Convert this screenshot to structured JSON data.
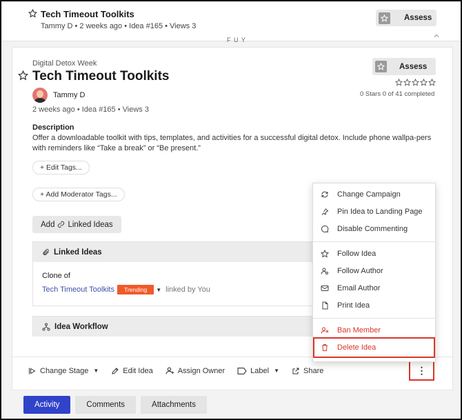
{
  "header": {
    "title": "Tech Timeout Toolkits",
    "meta": "Tammy D • 2 weeks ago • Idea #165 • Views 3",
    "assess_label": "Assess",
    "cut_text": "F U Y"
  },
  "idea": {
    "campaign": "Digital Detox Week",
    "title": "Tech Timeout Toolkits",
    "assess_label": "Assess",
    "stars_summary": "0 Stars 0 of 41 completed",
    "rating": {
      "value": 0,
      "max": 5
    },
    "author": "Tammy D",
    "meta": "2 weeks ago • Idea #165 • Views 3",
    "description_heading": "Description",
    "description": "Offer a downloadable toolkit with tips, templates, and activities for a successful digital detox. Include phone wallpa-pers with reminders like “Take a break” or “Be present.”",
    "edit_tags_label": "+ Edit Tags...",
    "moderator_tags_label": "+ Add Moderator Tags...",
    "add_linked_label": "Add",
    "add_linked_suffix": "Linked Ideas"
  },
  "linked_ideas": {
    "heading": "Linked Ideas",
    "clone_of": "Clone of",
    "link_text": "Tech Timeout Toolkits",
    "badge": "Trending",
    "linked_by": "linked by You"
  },
  "workflow": {
    "heading": "Idea Workflow"
  },
  "actions": {
    "change_stage": "Change Stage",
    "edit_idea": "Edit Idea",
    "assign_owner": "Assign Owner",
    "label": "Label",
    "share": "Share"
  },
  "tabs": [
    "Activity",
    "Comments",
    "Attachments"
  ],
  "menu": {
    "items": [
      {
        "label": "Change Campaign",
        "icon": "refresh-icon"
      },
      {
        "label": "Pin Idea to Landing Page",
        "icon": "pin-icon"
      },
      {
        "label": "Disable Commenting",
        "icon": "comment-icon"
      },
      {
        "label": "Follow Idea",
        "icon": "star-icon"
      },
      {
        "label": "Follow Author",
        "icon": "user-follow-icon"
      },
      {
        "label": "Email Author",
        "icon": "mail-icon"
      },
      {
        "label": "Print Idea",
        "icon": "pdf-icon"
      },
      {
        "label": "Ban Member",
        "icon": "user-ban-icon"
      },
      {
        "label": "Delete Idea",
        "icon": "trash-icon"
      }
    ]
  },
  "colors": {
    "primary": "#3043c9",
    "danger": "#d9362b",
    "trending": "#f05a28",
    "link": "#3f51a7"
  }
}
